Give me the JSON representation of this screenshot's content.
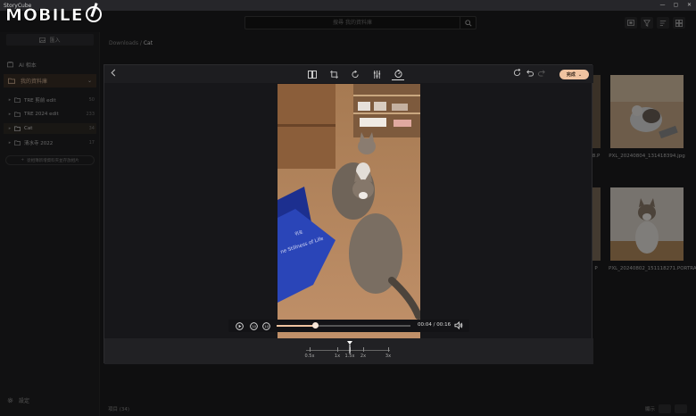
{
  "app": {
    "title": "StoryCube",
    "logo_text": "MOBILE01"
  },
  "window_controls": [
    "—",
    "▢",
    "✕"
  ],
  "search": {
    "placeholder": "搜尋 我的資料庫"
  },
  "sidebar": {
    "import_label": "匯入",
    "ai_label": "AI 相本",
    "library_label": "我的資料庫",
    "folders": [
      {
        "name": "TRE 剪前 edit",
        "count": "50"
      },
      {
        "name": "TRE 2024 edit",
        "count": "233"
      },
      {
        "name": "Cat",
        "count": "34"
      },
      {
        "name": "清水寺 2022",
        "count": "17"
      }
    ],
    "add_album_label": "從相簿新增資料夾並存放相片",
    "settings_label": "設定"
  },
  "breadcrumb": {
    "parent": "Downloads",
    "separator": "/",
    "current": "Cat"
  },
  "gallery": {
    "labels": {
      "left_1": "8.P",
      "left_2": "P",
      "right_1": "PXL_20240804_131418394.jpg",
      "right_2": "PXL_20240802_151118271.PORTRAIT.jpg"
    }
  },
  "statusbar": {
    "selected": "項目 (34)",
    "view_label": "顯示"
  },
  "editor": {
    "done_label": "完成",
    "tools": [
      "compare-icon",
      "crop-icon",
      "rotate-icon",
      "adjust-icon",
      "speed-icon"
    ],
    "video": {
      "current_time": "00:04",
      "duration": "00:16",
      "progress": 0.29,
      "video_text": [
        "위로",
        "ne Stillness of Life"
      ]
    },
    "speed": {
      "ticks": [
        "0.5x",
        "1x",
        "1.5x",
        "2x",
        "3x"
      ],
      "selected": "1.5x"
    }
  },
  "colors": {
    "accent": "#f0c3a0",
    "selected_folder": "#2f2a25",
    "library_bg": "#3a2e26"
  }
}
